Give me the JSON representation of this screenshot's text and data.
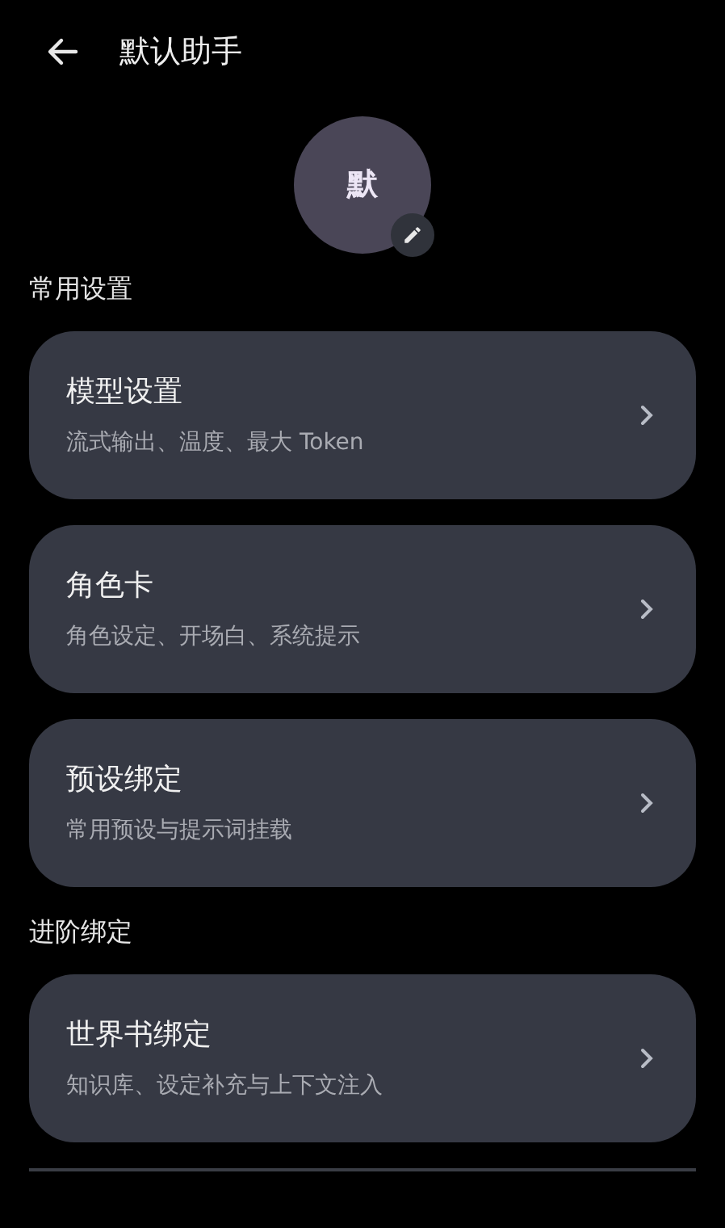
{
  "header": {
    "title": "默认助手"
  },
  "avatar": {
    "initial": "默"
  },
  "sections": [
    {
      "title": "常用设置",
      "items": [
        {
          "title": "模型设置",
          "subtitle": "流式输出、温度、最大 Token"
        },
        {
          "title": "角色卡",
          "subtitle": "角色设定、开场白、系统提示"
        },
        {
          "title": "预设绑定",
          "subtitle": "常用预设与提示词挂载"
        }
      ]
    },
    {
      "title": "进阶绑定",
      "items": [
        {
          "title": "世界书绑定",
          "subtitle": "知识库、设定补充与上下文注入"
        }
      ]
    }
  ]
}
